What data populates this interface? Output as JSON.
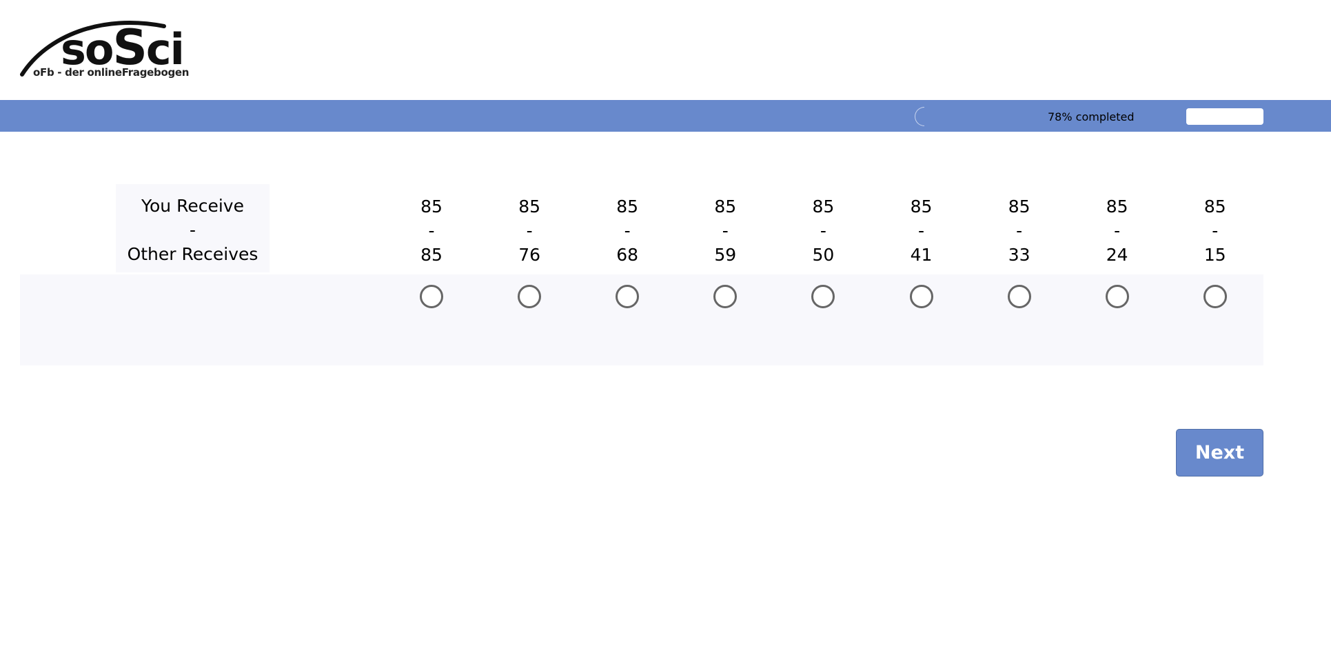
{
  "logo": {
    "wordmark_part1": "so",
    "wordmark_part2": "S",
    "wordmark_part3": "ci",
    "subtitle": "oFb - der onlineFragebogen"
  },
  "progress": {
    "text": "78% completed",
    "percent": 78
  },
  "question": {
    "header_line1": "You Receive",
    "header_sep": "-",
    "header_line2": "Other Receives",
    "options": [
      {
        "you": "85",
        "sep": "-",
        "other": "85"
      },
      {
        "you": "85",
        "sep": "-",
        "other": "76"
      },
      {
        "you": "85",
        "sep": "-",
        "other": "68"
      },
      {
        "you": "85",
        "sep": "-",
        "other": "59"
      },
      {
        "you": "85",
        "sep": "-",
        "other": "50"
      },
      {
        "you": "85",
        "sep": "-",
        "other": "41"
      },
      {
        "you": "85",
        "sep": "-",
        "other": "33"
      },
      {
        "you": "85",
        "sep": "-",
        "other": "24"
      },
      {
        "you": "85",
        "sep": "-",
        "other": "15"
      }
    ]
  },
  "navigation": {
    "next_label": "Next"
  },
  "colors": {
    "accent": "#6889cc",
    "row_background": "#f8f8fc",
    "radio_border": "#666666"
  }
}
